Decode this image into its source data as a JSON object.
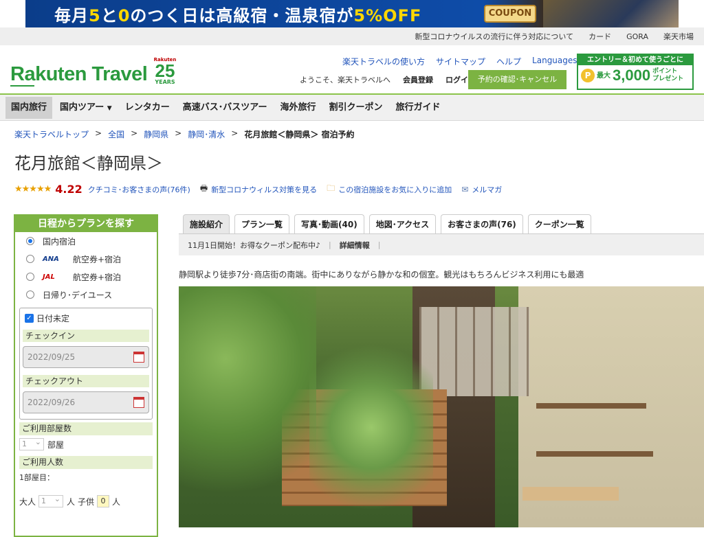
{
  "banner": {
    "text_a": "毎月",
    "text_5": "5",
    "text_b": "と",
    "text_0": "0",
    "text_c": "のつく日は高級宿・温泉宿が",
    "text_off": "5%OFF",
    "coupon": "COUPON",
    "next_icon": "chevron-right-icon"
  },
  "util": {
    "items": [
      "新型コロナウイルスの流行に伴う対応について",
      "カード",
      "GORA",
      "楽天市場"
    ]
  },
  "header": {
    "logo": "Rakuten Travel",
    "anniv_brand": "Rakuten",
    "anniv_num": "25",
    "anniv_years": "YEARS",
    "links": [
      "楽天トラベルの使い方",
      "サイトマップ",
      "ヘルプ",
      "Languages"
    ],
    "welcome": "ようこそ、楽天トラベルへ",
    "register": "会員登録",
    "login": "ログイン",
    "reserve_btn": "予約の確認･キャンセル",
    "promo_top": "エントリー＆初めて使うごとに",
    "promo_coin": "P",
    "promo_max": "最大",
    "promo_amount": "3,000",
    "promo_pts1": "ポイント",
    "promo_pts2": "プレゼント"
  },
  "gnav": {
    "items": [
      "国内旅行",
      "国内ツアー",
      "レンタカー",
      "高速バス･バスツアー",
      "海外旅行",
      "割引クーポン",
      "旅行ガイド"
    ]
  },
  "breadcrumb": {
    "items": [
      "楽天トラベルトップ",
      "全国",
      "静岡県",
      "静岡･清水"
    ],
    "current": "花月旅館＜静岡県＞ 宿泊予約",
    "sep": ">"
  },
  "hotel": {
    "title": "花月旅館＜静岡県＞",
    "stars": "★★★★★",
    "score": "4.22",
    "reviews_link": "クチコミ･お客さまの声(76件)",
    "covid_link": "新型コロナウィルス対策を見る",
    "fav_link": "この宿泊施設をお気に入りに追加",
    "mail_link": "メルマガ",
    "description": "静岡駅より徒歩7分･商店街の南端。街中にありながら静かな和の個室。観光はもちろんビジネス利用にも最適"
  },
  "sidebar": {
    "title": "日程からプランを探す",
    "radio_domestic": "国内宿泊",
    "ana_logo": "ANA",
    "ana_label": "航空券+宿泊",
    "jal_logo": "JAL",
    "jal_label": "航空券+宿泊",
    "radio_day": "日帰り･デイユース",
    "date_undecided": "日付未定",
    "checkin_label": "チェックイン",
    "checkin_value": "2022/09/25",
    "checkout_label": "チェックアウト",
    "checkout_value": "2022/09/26",
    "rooms_label": "ご利用部屋数",
    "rooms_value": "1",
    "rooms_unit": "部屋",
    "guests_label": "ご利用人数",
    "room1_label": "1部屋目：",
    "adult_label": "大人",
    "adult_value": "1",
    "adult_unit": "人",
    "child_label": "子供",
    "child_value": "0",
    "child_unit": "人"
  },
  "tabs": {
    "items": [
      "施設紹介",
      "プラン一覧",
      "写真･動画(40)",
      "地図･アクセス",
      "お客さまの声(76)",
      "クーポン一覧"
    ],
    "notice": "11月1日開始！お得なクーポン配布中♪",
    "detail": "詳細情報",
    "sep": "|"
  },
  "colors": {
    "brand_green": "#2b9a3e",
    "accent_green": "#7cb342",
    "link_blue": "#2255bb",
    "score_red": "#bf0000"
  }
}
